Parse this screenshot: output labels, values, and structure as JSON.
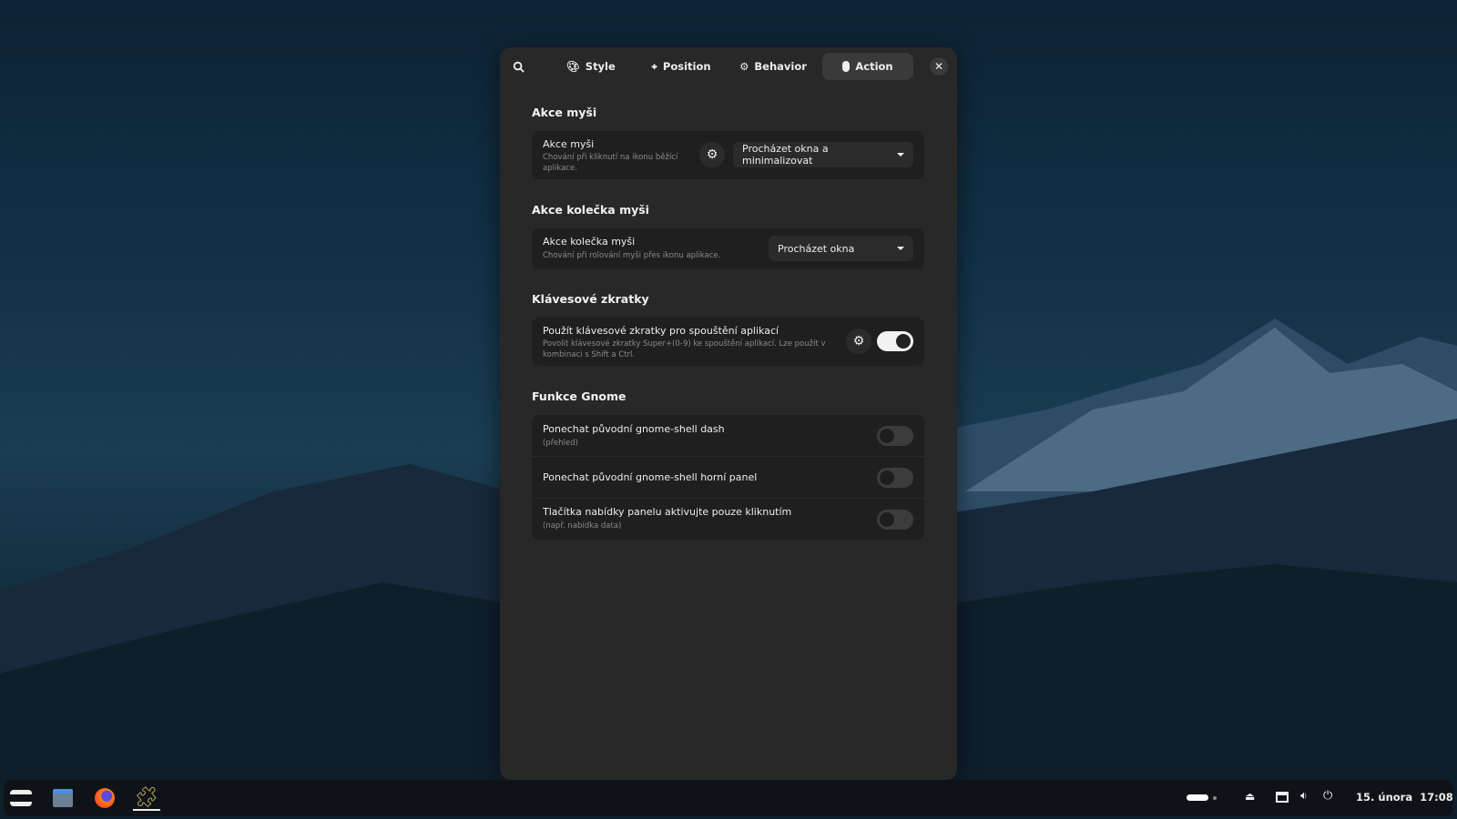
{
  "tabs": [
    {
      "label": "Style",
      "icon": "palette-icon"
    },
    {
      "label": "Position",
      "icon": "crosshair-icon"
    },
    {
      "label": "Behavior",
      "icon": "gear-icon"
    },
    {
      "label": "Action",
      "icon": "mouse-icon",
      "active": true
    }
  ],
  "sections": {
    "mouse": {
      "heading": "Akce myši",
      "label": "Akce myši",
      "desc": "Chování při kliknutí na ikonu běžící aplikace.",
      "value": "Procházet okna a minimalizovat"
    },
    "scroll": {
      "heading": "Akce kolečka myši",
      "label": "Akce kolečka myši",
      "desc": "Chování při rolování myši přes ikonu aplikace.",
      "value": "Procházet okna"
    },
    "shortcuts": {
      "heading": "Klávesové zkratky",
      "label": "Použít klávesové zkratky pro spouštění aplikací",
      "desc": "Povolit klávesové zkratky Super+(0-9) ke spouštění aplikací. Lze použít v kombinaci s Shift a Ctrl.",
      "enabled": true
    },
    "gnome": {
      "heading": "Funkce Gnome",
      "rows": [
        {
          "label": "Ponechat původní gnome-shell dash",
          "desc": "(přehled)",
          "enabled": false
        },
        {
          "label": "Ponechat původní gnome-shell horní panel",
          "desc": "",
          "enabled": false
        },
        {
          "label": "Tlačítka nabídky panelu aktivujte pouze kliknutím",
          "desc": "(např. nabídka data)",
          "enabled": false
        }
      ]
    }
  },
  "taskbar": {
    "date": "15. února",
    "time": "17:08"
  }
}
